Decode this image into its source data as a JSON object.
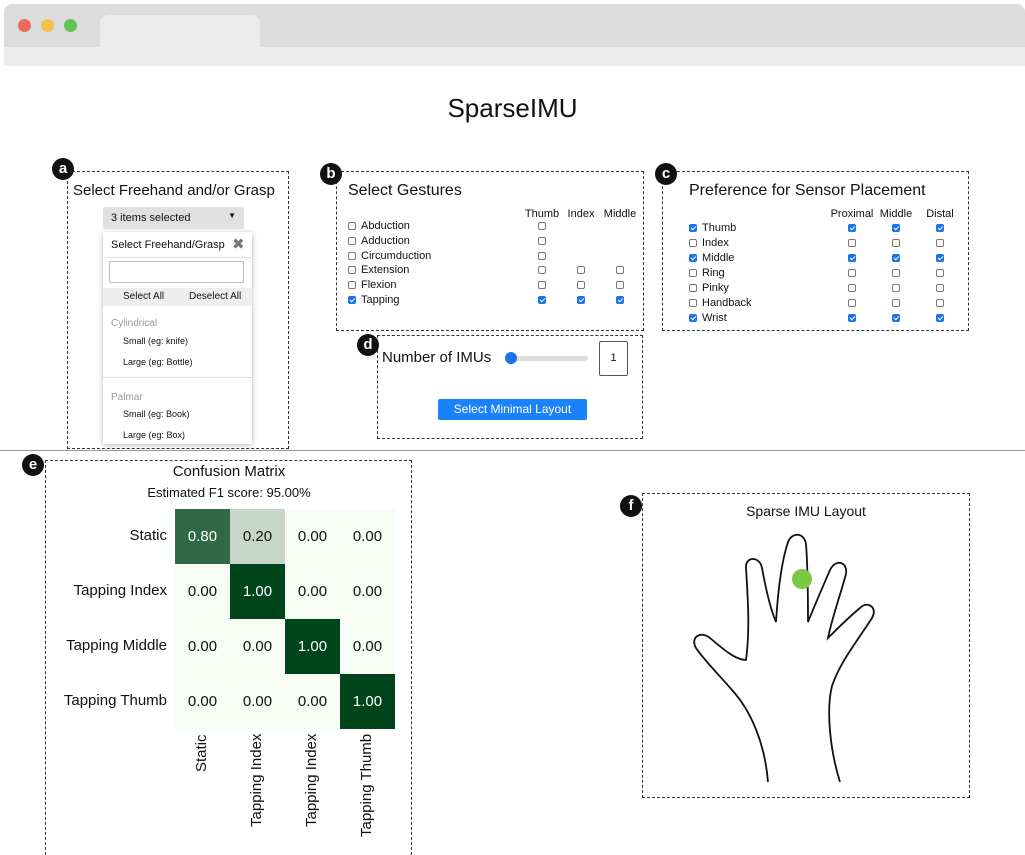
{
  "app_title": "SparseIMU",
  "panels": {
    "a": {
      "badge": "a",
      "title": "Select Freehand and/or Grasp",
      "dropdown_value": "3 items selected",
      "menu_title": "Select Freehand/Grasp",
      "select_all": "Select All",
      "deselect_all": "Deselect All",
      "groups": [
        {
          "label": "Cylindrical",
          "items": [
            "Small (eg: knife)",
            "Large (eg: Bottle)"
          ]
        },
        {
          "label": "Palmar",
          "items": [
            "Small (eg: Book)",
            "Large (eg: Box)"
          ]
        }
      ]
    },
    "b": {
      "badge": "b",
      "title": "Select Gestures",
      "columns": [
        "Thumb",
        "Index",
        "Middle"
      ],
      "rows": [
        {
          "label": "Abduction",
          "checked": false,
          "cols": [
            false,
            null,
            null
          ]
        },
        {
          "label": "Adduction",
          "checked": false,
          "cols": [
            false,
            null,
            null
          ]
        },
        {
          "label": "Circumduction",
          "checked": false,
          "cols": [
            false,
            null,
            null
          ]
        },
        {
          "label": "Extension",
          "checked": false,
          "cols": [
            false,
            false,
            false
          ]
        },
        {
          "label": "Flexion",
          "checked": false,
          "cols": [
            false,
            false,
            false
          ]
        },
        {
          "label": "Tapping",
          "checked": true,
          "cols": [
            true,
            true,
            true
          ]
        }
      ]
    },
    "c": {
      "badge": "c",
      "title": "Preference for Sensor Placement",
      "columns": [
        "Proximal",
        "Middle",
        "Distal"
      ],
      "rows": [
        {
          "label": "Thumb",
          "checked": true,
          "cols": [
            true,
            true,
            true
          ]
        },
        {
          "label": "Index",
          "checked": false,
          "cols": [
            false,
            false,
            false
          ]
        },
        {
          "label": "Middle",
          "checked": true,
          "cols": [
            true,
            true,
            true
          ]
        },
        {
          "label": "Ring",
          "checked": false,
          "cols": [
            false,
            false,
            false
          ]
        },
        {
          "label": "Pinky",
          "checked": false,
          "cols": [
            false,
            false,
            false
          ]
        },
        {
          "label": "Handback",
          "checked": false,
          "cols": [
            false,
            false,
            false
          ]
        },
        {
          "label": "Wrist",
          "checked": true,
          "cols": [
            true,
            true,
            true
          ]
        }
      ]
    },
    "d": {
      "badge": "d",
      "label": "Number of IMUs",
      "value": "1",
      "button": "Select Minimal Layout"
    },
    "e": {
      "badge": "e",
      "title": "Confusion Matrix",
      "subtitle": "Estimated F1 score: 95.00%",
      "row_labels": [
        "Static",
        "Tapping Index",
        "Tapping Middle",
        "Tapping Thumb"
      ],
      "col_labels": [
        "Static",
        "Tapping Index",
        "Tapping Index",
        "Tapping Thumb"
      ],
      "matrix": [
        [
          "0.80",
          "0.20",
          "0.00",
          "0.00"
        ],
        [
          "0.00",
          "1.00",
          "0.00",
          "0.00"
        ],
        [
          "0.00",
          "0.00",
          "1.00",
          "0.00"
        ],
        [
          "0.00",
          "0.00",
          "0.00",
          "1.00"
        ]
      ]
    },
    "f": {
      "badge": "f",
      "title": "Sparse IMU Layout",
      "marker_color": "#7ac943"
    }
  },
  "colors": {
    "accent": "#1a82fb",
    "matrix_high": "#00441b",
    "matrix_low": "#f7fcf5"
  }
}
